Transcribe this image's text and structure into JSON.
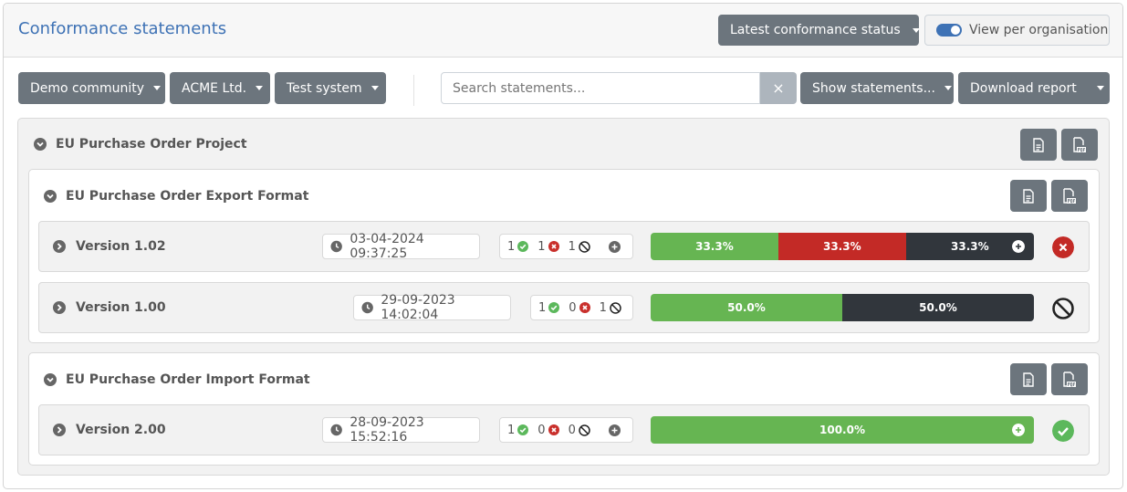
{
  "header": {
    "title": "Conformance statements",
    "status_dropdown": "Latest conformance status",
    "toggle_label": "View per organisation"
  },
  "filters": {
    "community": "Demo community",
    "organisation": "ACME Ltd.",
    "system": "Test system",
    "search_placeholder": "Search statements...",
    "clear_glyph": "×",
    "show_statements": "Show statements...",
    "download_report": "Download report"
  },
  "project": {
    "name": "EU Purchase Order Project",
    "specs": [
      {
        "name": "EU Purchase Order Export Format",
        "versions": [
          {
            "name": "Version 1.02",
            "date": "03-04-2024 09:37:25",
            "success": "1",
            "failed": "1",
            "undefined": "1",
            "segments": [
              "33.3%",
              "33.3%",
              "33.3%"
            ],
            "status": "failed"
          },
          {
            "name": "Version 1.00",
            "date": "29-09-2023 14:02:04",
            "success": "1",
            "failed": "0",
            "undefined": "1",
            "segments": [
              "50.0%",
              "50.0%"
            ],
            "status": "undefined"
          }
        ]
      },
      {
        "name": "EU Purchase Order Import Format",
        "versions": [
          {
            "name": "Version 2.00",
            "date": "28-09-2023 15:52:16",
            "success": "1",
            "failed": "0",
            "undefined": "0",
            "segments": [
              "100.0%"
            ],
            "status": "success"
          }
        ]
      }
    ]
  },
  "colors": {
    "accent": "#3e72b5",
    "success": "#66b552",
    "failure": "#c32a26",
    "undefined": "#31363c",
    "button": "#6c757d"
  }
}
